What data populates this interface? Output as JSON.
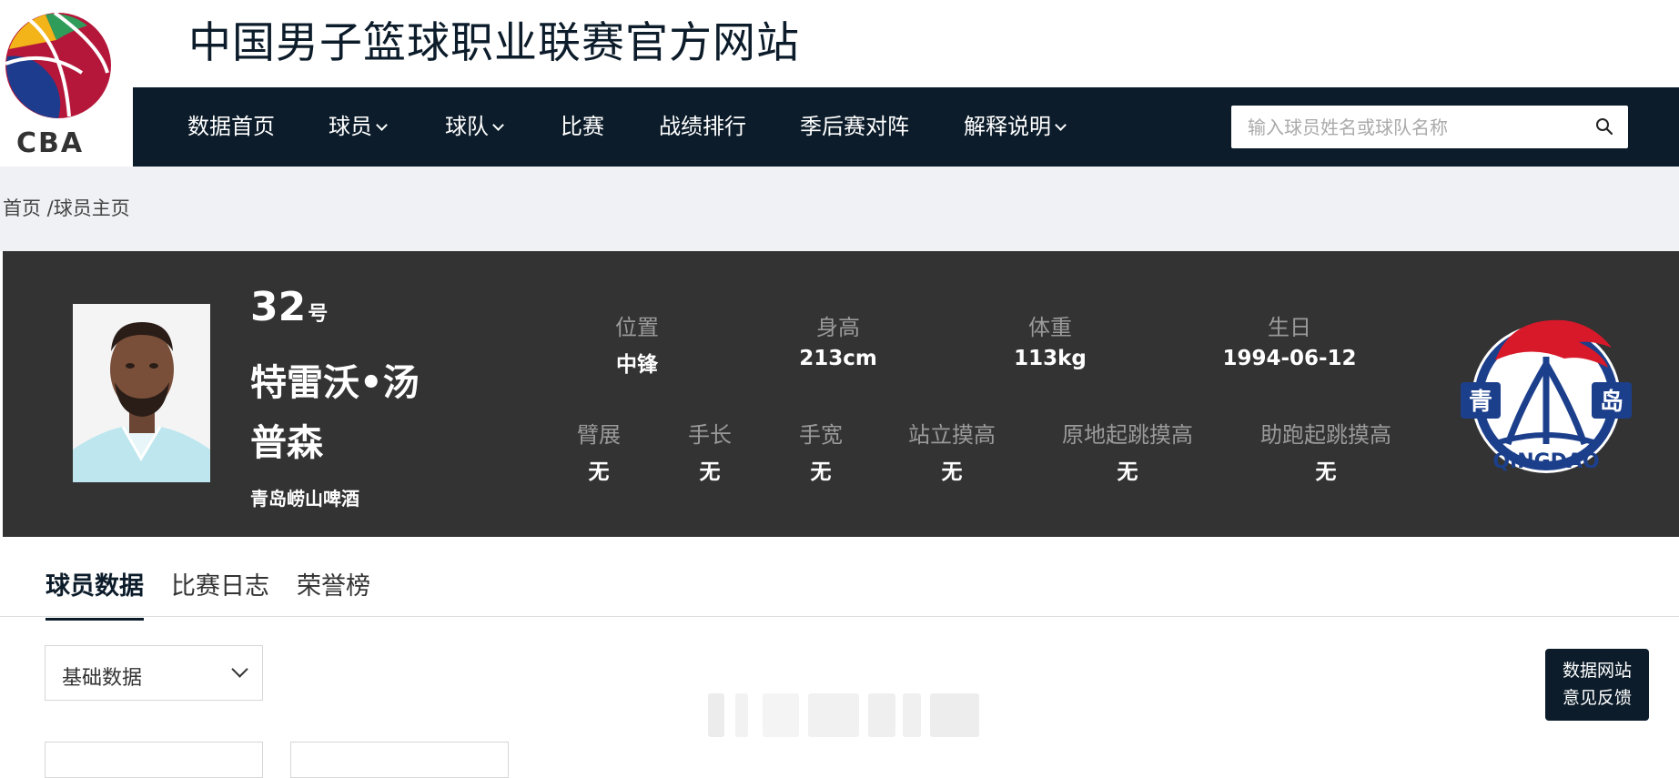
{
  "brand": {
    "logo_text": "CBA",
    "site_title": "中国男子篮球职业联赛官方网站"
  },
  "nav": {
    "items": [
      {
        "label": "数据首页",
        "has_dropdown": false
      },
      {
        "label": "球员",
        "has_dropdown": true
      },
      {
        "label": "球队",
        "has_dropdown": true
      },
      {
        "label": "比赛",
        "has_dropdown": false
      },
      {
        "label": "战绩排行",
        "has_dropdown": false
      },
      {
        "label": "季后赛对阵",
        "has_dropdown": false
      },
      {
        "label": "解释说明",
        "has_dropdown": true
      }
    ],
    "search_placeholder": "输入球员姓名或球队名称",
    "search_icon": "search-icon"
  },
  "breadcrumb": {
    "home": "首页",
    "separator": " /",
    "current": "球员主页"
  },
  "player": {
    "number": "32",
    "number_suffix": "号",
    "name": "特雷沃•汤普森",
    "team": "青岛崂山啤酒",
    "stats_row1": [
      {
        "label": "位置",
        "value": "中锋"
      },
      {
        "label": "身高",
        "value": "213cm"
      },
      {
        "label": "体重",
        "value": "113kg"
      },
      {
        "label": "生日",
        "value": "1994-06-12"
      }
    ],
    "stats_row2": [
      {
        "label": "臂展",
        "value": "无"
      },
      {
        "label": "手长",
        "value": "无"
      },
      {
        "label": "手宽",
        "value": "无"
      },
      {
        "label": "站立摸高",
        "value": "无"
      },
      {
        "label": "原地起跳摸高",
        "value": "无"
      },
      {
        "label": "助跑起跳摸高",
        "value": "无"
      }
    ],
    "team_logo_text": {
      "left": "青",
      "right": "岛",
      "bottom": "QINGDAO"
    }
  },
  "tabs": [
    {
      "label": "球员数据",
      "active": true
    },
    {
      "label": "比赛日志",
      "active": false
    },
    {
      "label": "荣誉榜",
      "active": false
    }
  ],
  "filter": {
    "selected": "基础数据"
  },
  "feedback": {
    "line1": "数据网站",
    "line2": "意见反馈"
  },
  "colors": {
    "nav_bg": "#0c1c2a",
    "banner_bg": "#333333",
    "crumb_bg": "#f0f1f5",
    "team_red": "#d7192a",
    "team_blue": "#1c3f8c"
  }
}
